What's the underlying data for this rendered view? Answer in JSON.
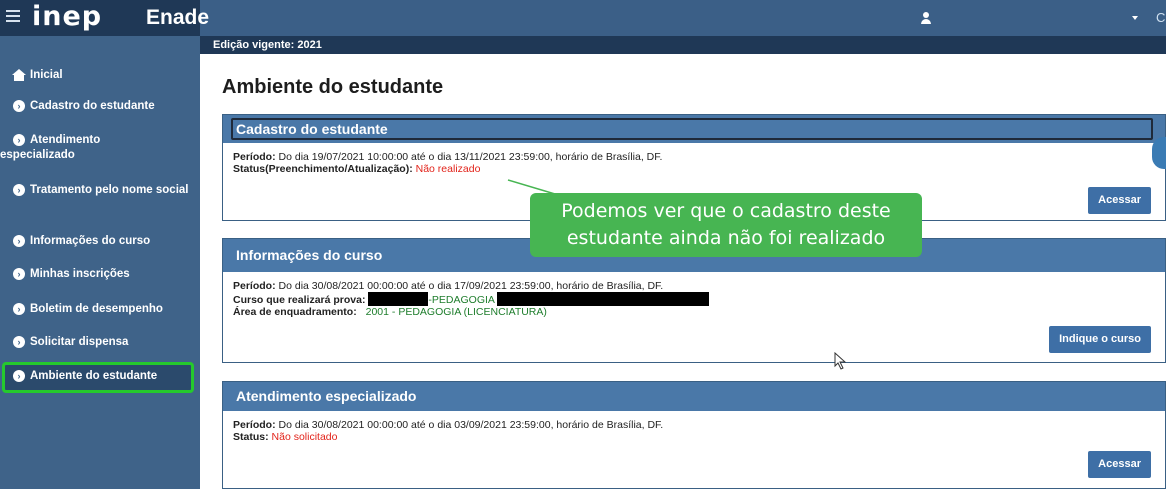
{
  "header": {
    "logo": "inep",
    "app_name": "Enade",
    "corner": "C"
  },
  "sidebar": {
    "items": [
      {
        "label": "Inicial"
      },
      {
        "label": "Cadastro do estudante"
      },
      {
        "label": "Atendimento especializado"
      },
      {
        "label": "Tratamento pelo nome social"
      },
      {
        "label": "Informações do curso"
      },
      {
        "label": "Minhas inscrições"
      },
      {
        "label": "Boletim de desempenho"
      },
      {
        "label": "Solicitar dispensa"
      },
      {
        "label": "Ambiente do estudante"
      }
    ]
  },
  "main": {
    "edition": "Edição vigente: 2021",
    "title": "Ambiente do estudante",
    "panels": [
      {
        "title": "Cadastro do estudante",
        "period_label": "Período:",
        "period": "Do dia 19/07/2021 10:00:00 até o dia 13/11/2021 23:59:00, horário de Brasília, DF.",
        "status_label": "Status(Preenchimento/Atualização):",
        "status": "Não realizado",
        "button": "Acessar"
      },
      {
        "title": "Informações do curso",
        "period_label": "Período:",
        "period": "Do dia 30/08/2021 00:00:00 até o dia 17/09/2021 23:59:00, horário de Brasília, DF.",
        "course_label": "Curso que realizará prova:",
        "course": "-PEDAGOGIA",
        "area_label": "Área de enquadramento:",
        "area": "2001 - PEDAGOGIA (LICENCIATURA)",
        "button": "Indique o curso"
      },
      {
        "title": "Atendimento especializado",
        "period_label": "Período:",
        "period": "Do dia 30/08/2021 00:00:00 até o dia 03/09/2021 23:59:00, horário de Brasília, DF.",
        "status_label": "Status:",
        "status": "Não solicitado",
        "button": "Acessar"
      }
    ]
  },
  "annotation": {
    "line1": "Podemos ver que o cadastro deste",
    "line2": "estudante ainda não foi realizado"
  },
  "colors": {
    "header": "#3b5f87",
    "sidebar": "#3f6389",
    "panel_header": "#4a78a8",
    "highlight": "#25c92d",
    "callout": "#47b552",
    "status_red": "#e2231a"
  }
}
